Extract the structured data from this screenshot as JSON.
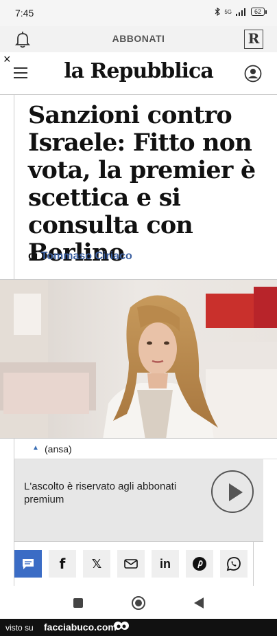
{
  "status_bar": {
    "time": "7:45",
    "network": "5G",
    "battery": "62"
  },
  "top_bar": {
    "subscribe_label": "ABBONATI",
    "app_logo": "R"
  },
  "header": {
    "close_symbol": "×",
    "brand": "la Repubblica"
  },
  "article": {
    "headline": "Sanzioni contro Israele: Fitto non vota, la premier è scettica e si consulta con Berlino",
    "byline_prefix": "di",
    "author": "Tommaso Ciriaco",
    "caption_arrow": "▲",
    "photo_caption": "(ansa)"
  },
  "audio": {
    "message": "L'ascolto è riservato agli abbonati premium"
  },
  "share": {
    "buttons": [
      {
        "icon": "comment-icon"
      },
      {
        "icon": "facebook-icon",
        "glyph": "f"
      },
      {
        "icon": "x-icon",
        "glyph": "𝕏"
      },
      {
        "icon": "mail-icon"
      },
      {
        "icon": "linkedin-icon",
        "glyph": "in"
      },
      {
        "icon": "pinterest-icon"
      },
      {
        "icon": "whatsapp-icon"
      }
    ]
  },
  "footer": {
    "visto_su": "visto su",
    "site": "facciabuco.com"
  },
  "colors": {
    "accent": "#3b6cc5",
    "author": "#3b5fa0",
    "footer_bg": "#111111"
  }
}
